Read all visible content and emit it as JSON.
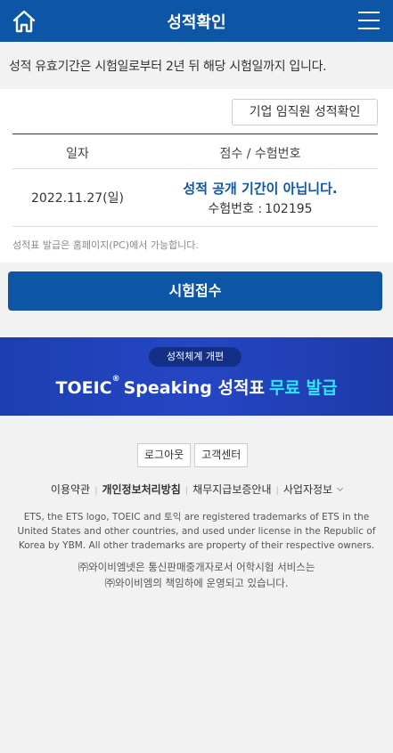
{
  "header": {
    "title": "성적확인",
    "home_icon": "home-icon",
    "menu_icon": "hamburger-menu-icon"
  },
  "notice": "성적 유효기간은 시험일로부터 2년 뒤 해당 시험일까지 입니다.",
  "score_card": {
    "corp_button": "기업 임직원 성적확인",
    "columns": [
      "일자",
      "점수 / 수험번호"
    ],
    "rows": [
      {
        "date": "2022.11.27(일)",
        "status": "성적 공개 기간이 아닙니다.",
        "reg_label": "수험번호 :",
        "reg_no": "102195"
      }
    ],
    "note": "성적표 발급은 홈페이지(PC)에서 가능합니다."
  },
  "exam_button": "시험접수",
  "banner": {
    "pill": "성적체계 개편",
    "headline_a": "TOEIC",
    "headline_sup": "®",
    "headline_b": "Speaking 성적표",
    "headline_c": "무료 발급"
  },
  "footer": {
    "buttons": [
      "로그아웃",
      "고객센터"
    ],
    "links": [
      "이용약관",
      "개인정보처리방침",
      "채무지급보증안내",
      "사업자정보"
    ],
    "legal_1": "ETS, the ETS logo, TOEIC and 토익 are registered trademarks of ETS in the United States and other countries, and used under license in the Republic of Korea by YBM. All other trademarks are property of their respective owners.",
    "legal_2a": "㈜와이비엠넷은 통신판매중개자로서 어학시험 서비스는",
    "legal_2b": "㈜와이비엠의 책임하에 운영되고 있습니다."
  },
  "colors": {
    "brand": "#0d56a6",
    "banner_accent": "#2ee6ff"
  }
}
